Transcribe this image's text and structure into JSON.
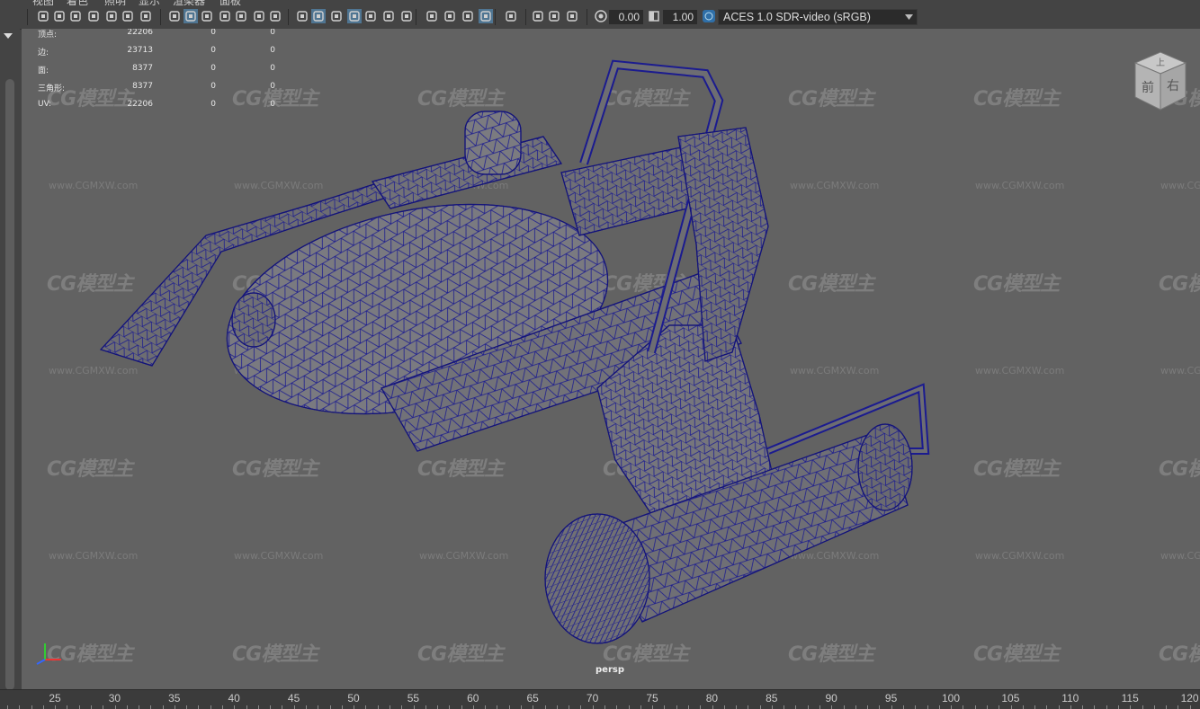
{
  "menu": {
    "items": [
      "视图",
      "着色",
      "照明",
      "显示",
      "渲染器",
      "面板"
    ]
  },
  "toolbar": {
    "exposure_value": "0.00",
    "gamma_value": "1.00",
    "color_space": "ACES 1.0 SDR-video (sRGB)",
    "icons": [
      "camera-icon",
      "camera-attr-icon",
      "bookmark-icon",
      "image-plane-icon",
      "grease-pencil-icon",
      "grid-icon",
      "film-gate-icon",
      "resolution-gate-icon",
      "gate-mask-icon",
      "field-chart-icon",
      "safe-action-icon",
      "safe-title-icon",
      "wireframe-icon",
      "smooth-shade-icon",
      "shade-default-icon",
      "wireframe-on-shaded-icon",
      "xray-icon",
      "default-lighting-icon",
      "shadows-icon",
      "screen-space-ao-icon",
      "motion-blur-icon",
      "anti-aliasing-icon",
      "depth-of-field-icon",
      "isolate-select-icon",
      "xray-joints-icon",
      "textured-icon",
      "two-sided-icon",
      "exposure-icon",
      "gamma-icon",
      "color-management-icon"
    ],
    "accent_color": "#5a9fd4"
  },
  "hud": {
    "rows": [
      {
        "label": "顶点:",
        "v1": "22206",
        "v2": "0",
        "v3": "0"
      },
      {
        "label": "边:",
        "v1": "23713",
        "v2": "0",
        "v3": "0"
      },
      {
        "label": "面:",
        "v1": "8377",
        "v2": "0",
        "v3": "0"
      },
      {
        "label": "三角形:",
        "v1": "8377",
        "v2": "0",
        "v3": "0"
      },
      {
        "label": "UV:",
        "v1": "22206",
        "v2": "0",
        "v3": "0"
      }
    ]
  },
  "viewport": {
    "camera_label": "persp",
    "background_color": "#626262",
    "wireframe_color": "#1a1a8c",
    "viewcube": {
      "face_front": "前",
      "face_right": "右",
      "face_top": "上"
    }
  },
  "watermark": {
    "logo_text": "CG模型主",
    "url_text": "www.CGMXW.com"
  },
  "timeslider": {
    "ticks": [
      "25",
      "30",
      "35",
      "40",
      "45",
      "50",
      "55",
      "60",
      "65",
      "70",
      "75",
      "80",
      "85",
      "90",
      "95",
      "100",
      "105",
      "110",
      "115",
      "120"
    ]
  }
}
